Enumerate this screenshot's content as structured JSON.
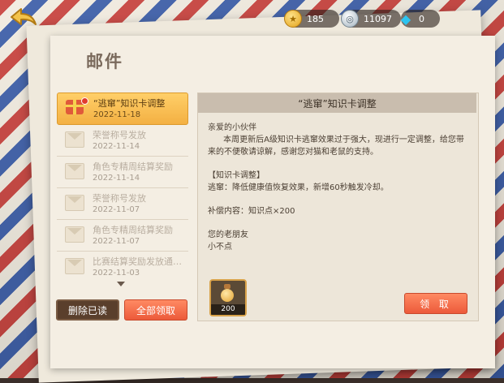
{
  "header": {
    "title": "邮件"
  },
  "currency": {
    "gold": "185",
    "silver": "11097",
    "gems": "0"
  },
  "mail_list": [
    {
      "title": "“逃窜”知识卡调整",
      "date": "2022-11-18",
      "active": true,
      "unread": true
    },
    {
      "title": "荣誉称号发放",
      "date": "2022-11-14",
      "active": false,
      "unread": false
    },
    {
      "title": "角色专精周结算奖励",
      "date": "2022-11-14",
      "active": false,
      "unread": false
    },
    {
      "title": "荣誉称号发放",
      "date": "2022-11-07",
      "active": false,
      "unread": false
    },
    {
      "title": "角色专精周结算奖励",
      "date": "2022-11-07",
      "active": false,
      "unread": false
    },
    {
      "title": "比赛结算奖励发放通…",
      "date": "2022-11-03",
      "active": false,
      "unread": false
    }
  ],
  "buttons": {
    "delete_read": "删除已读",
    "claim_all": "全部领取",
    "claim": "领 取"
  },
  "detail": {
    "title": "“逃窜”知识卡调整",
    "greeting": "亲爱的小伙伴",
    "para1": "      本周更新后A级知识卡逃窜效果过于强大，现进行一定调整，给您带来的不便敬请谅解，感谢您对猫和老鼠的支持。",
    "section": "【知识卡调整】",
    "line2": "逃窜：降低健康值恢复效果，新增60秒触发冷却。",
    "compensation": "补偿内容：知识点×200",
    "signoff1": "您的老朋友",
    "signoff2": "小不点",
    "reward_count": "200"
  }
}
